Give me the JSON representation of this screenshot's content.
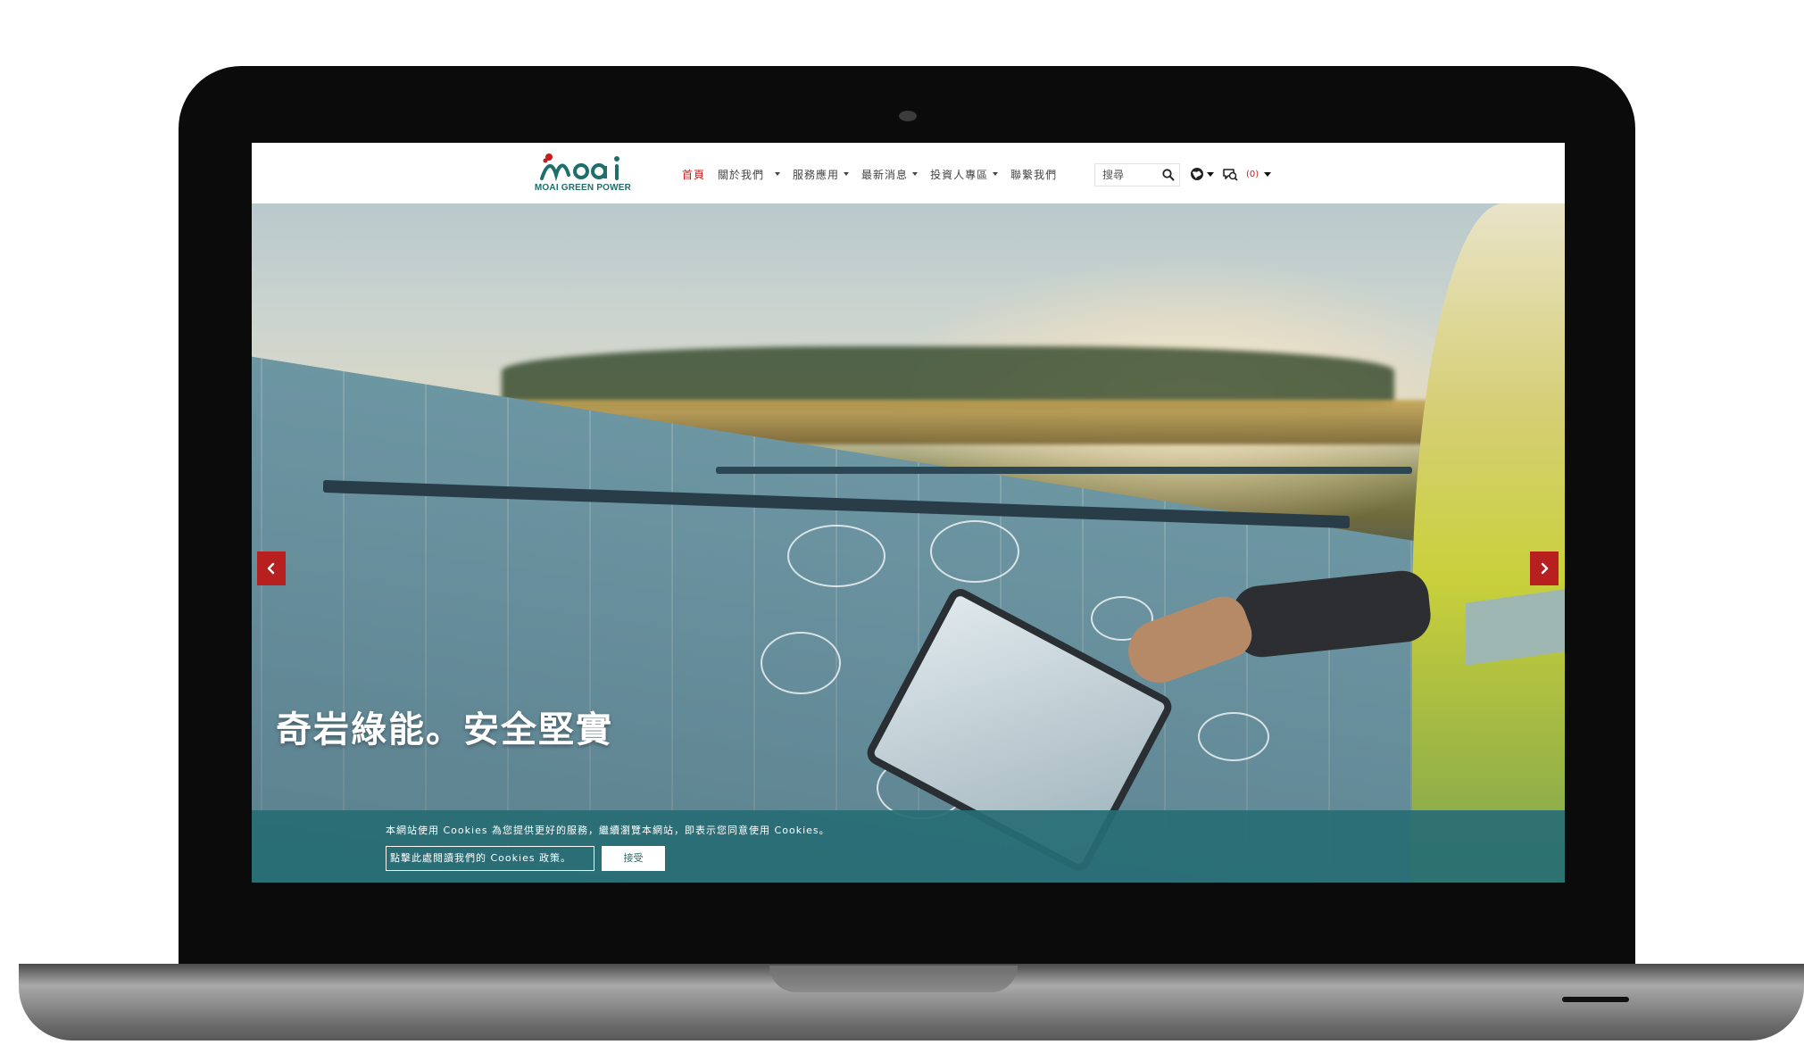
{
  "brand": {
    "name": "moai",
    "tagline": "MOAI GREEN POWER",
    "color": "#1e6e6c",
    "accent": "#c41d1d"
  },
  "nav": {
    "items": [
      {
        "label": "首頁",
        "active": true,
        "has_dropdown": false
      },
      {
        "label": "關於我們",
        "active": false,
        "has_dropdown": true
      },
      {
        "label": "服務應用",
        "active": false,
        "has_dropdown": true
      },
      {
        "label": "最新消息",
        "active": false,
        "has_dropdown": true
      },
      {
        "label": "投資人專區",
        "active": false,
        "has_dropdown": true
      },
      {
        "label": "聯繫我們",
        "active": false,
        "has_dropdown": false
      }
    ]
  },
  "search": {
    "placeholder": "搜尋",
    "icon": "search-icon"
  },
  "utilities": {
    "language_icon": "globe-icon",
    "inquiry_icon": "inquiry-icon",
    "inquiry_count": "(0)"
  },
  "hero": {
    "title": "奇岩綠能。安全堅實",
    "prev_icon": "chevron-left-icon",
    "next_icon": "chevron-right-icon",
    "arrow_color": "#b81f1f"
  },
  "cookie": {
    "message": "本網站使用 Cookies 為您提供更好的服務，繼續瀏覽本網站，即表示您同意使用 Cookies。",
    "policy_link": "點擊此處閱讀我們的 Cookies 政策。",
    "accept_label": "接受",
    "bar_color": "#276c74"
  }
}
